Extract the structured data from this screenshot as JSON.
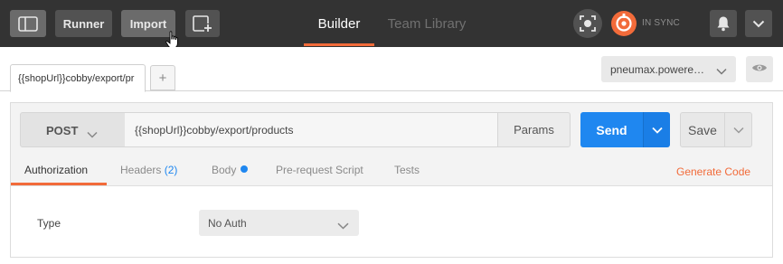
{
  "toolbar": {
    "runner_label": "Runner",
    "import_label": "Import",
    "sync_status": "IN SYNC"
  },
  "nav": {
    "tabs": [
      {
        "label": "Builder",
        "active": true
      },
      {
        "label": "Team Library",
        "active": false
      }
    ]
  },
  "request_tabs": {
    "items": [
      {
        "label": "{{shopUrl}}cobby/export/pr"
      }
    ],
    "add_label": "+"
  },
  "environment": {
    "selected": "pneumax.powere…"
  },
  "request": {
    "method": "POST",
    "url": "{{shopUrl}}cobby/export/products",
    "params_label": "Params",
    "send_label": "Send",
    "save_label": "Save"
  },
  "request_subtabs": {
    "authorization": "Authorization",
    "headers": "Headers",
    "headers_count": "(2)",
    "body": "Body",
    "prerequest": "Pre-request Script",
    "tests": "Tests",
    "generate_code": "Generate Code"
  },
  "auth": {
    "type_label": "Type",
    "type_value": "No Auth"
  },
  "colors": {
    "accent": "#f26b3a",
    "send_blue": "#1f87f0",
    "toolbar_bg": "#333333"
  },
  "icons": [
    "sidebar-toggle-icon",
    "new-window-icon",
    "cursor-hand-icon",
    "interceptor-icon",
    "sync-icon",
    "bell-icon",
    "chevron-down-icon",
    "eye-icon"
  ]
}
